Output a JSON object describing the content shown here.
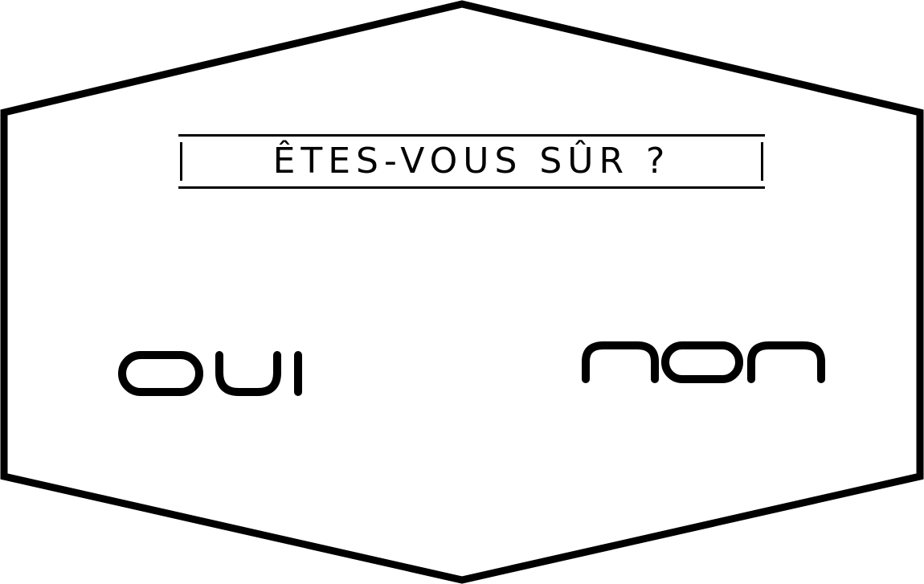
{
  "dialog": {
    "title": "ÊTES-VOUS SÛR ?",
    "yes_label": "OUI",
    "no_label": "NON"
  },
  "colors": {
    "stroke": "#000000",
    "background": "#ffffff"
  }
}
